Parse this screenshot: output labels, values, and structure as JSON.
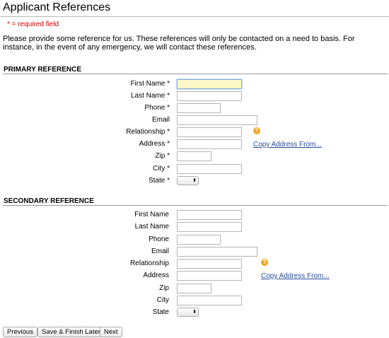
{
  "page": {
    "title": "Applicant References",
    "required_note": "* = required field",
    "intro": "Please provide some reference for us. These references will only be contacted on a need to basis. For instance, in the event of any emergency, we will contact these references."
  },
  "primary": {
    "heading": "PRIMARY REFERENCE",
    "labels": {
      "first_name": "First Name *",
      "last_name": "Last Name *",
      "phone": "Phone *",
      "email": "Email",
      "relationship": "Relationship *",
      "address": "Address *",
      "zip": "Zip *",
      "city": "City *",
      "state": "State *"
    },
    "values": {
      "first_name": "",
      "last_name": "",
      "phone": "",
      "email": "",
      "relationship": "",
      "address": "",
      "zip": "",
      "city": ""
    },
    "state_selected": "",
    "copy_address_link": "Copy Address From..."
  },
  "secondary": {
    "heading": "SECONDARY REFERENCE",
    "labels": {
      "first_name": "First Name",
      "last_name": "Last Name",
      "phone": "Phone",
      "email": "Email",
      "relationship": "Relationship",
      "address": "Address",
      "zip": "Zip",
      "city": "City",
      "state": "State"
    },
    "values": {
      "first_name": "",
      "last_name": "",
      "phone": "",
      "email": "",
      "relationship": "",
      "address": "",
      "zip": "",
      "city": ""
    },
    "state_selected": "",
    "copy_address_link": "Copy Address From..."
  },
  "icons": {
    "help": "question-mark-icon",
    "select_arrow": "up-down-arrows-icon",
    "help_glyph": "?",
    "select_glyph": "⬍"
  },
  "colors": {
    "required": "#d20000",
    "link": "#2a4e9a",
    "focus_field": "#fbf8c8",
    "help_icon": "#f0a81e"
  },
  "buttons": {
    "previous": "Previous",
    "save_finish_later": "Save & Finish Later",
    "next": "Next"
  }
}
